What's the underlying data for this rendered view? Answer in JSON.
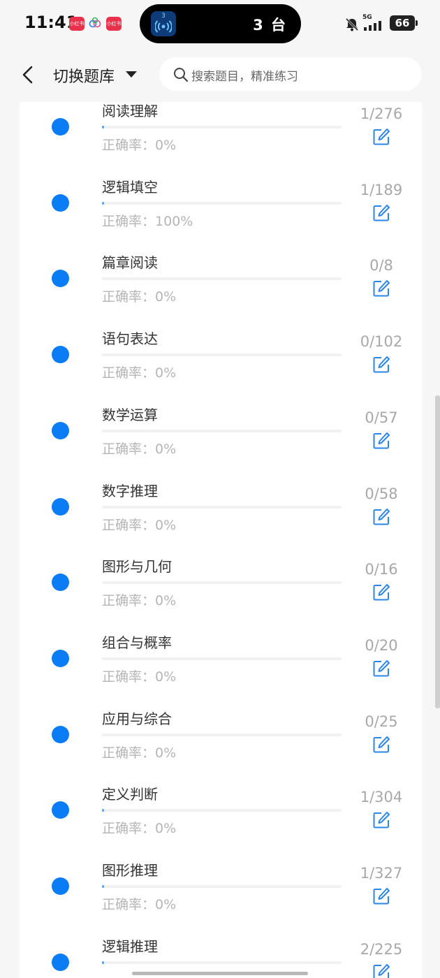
{
  "status_bar": {
    "time": "11:41",
    "app_badge_1": "小红书",
    "app_badge_2": "小红书",
    "island_badge": "3",
    "island_text": "3 台",
    "network": "5G",
    "battery": "66"
  },
  "header": {
    "title": "切换题库",
    "search_placeholder": "搜索题目，精准练习"
  },
  "accuracy_prefix": "正确率：",
  "colors": {
    "accent": "#0a7cf5",
    "progress": "#5ba6e8"
  },
  "items": [
    {
      "name": "阅读理解",
      "accuracy": "0%",
      "count": "1/276",
      "progress": 0.0036
    },
    {
      "name": "逻辑填空",
      "accuracy": "100%",
      "count": "1/189",
      "progress": 0.0053
    },
    {
      "name": "篇章阅读",
      "accuracy": "0%",
      "count": "0/8",
      "progress": 0
    },
    {
      "name": "语句表达",
      "accuracy": "0%",
      "count": "0/102",
      "progress": 0
    },
    {
      "name": "数学运算",
      "accuracy": "0%",
      "count": "0/57",
      "progress": 0
    },
    {
      "name": "数字推理",
      "accuracy": "0%",
      "count": "0/58",
      "progress": 0
    },
    {
      "name": "图形与几何",
      "accuracy": "0%",
      "count": "0/16",
      "progress": 0
    },
    {
      "name": "组合与概率",
      "accuracy": "0%",
      "count": "0/20",
      "progress": 0
    },
    {
      "name": "应用与综合",
      "accuracy": "0%",
      "count": "0/25",
      "progress": 0
    },
    {
      "name": "定义判断",
      "accuracy": "0%",
      "count": "1/304",
      "progress": 0.0033
    },
    {
      "name": "图形推理",
      "accuracy": "0%",
      "count": "1/327",
      "progress": 0.0031
    },
    {
      "name": "逻辑推理",
      "accuracy": "",
      "count": "2/225",
      "progress": 0.0089
    }
  ]
}
